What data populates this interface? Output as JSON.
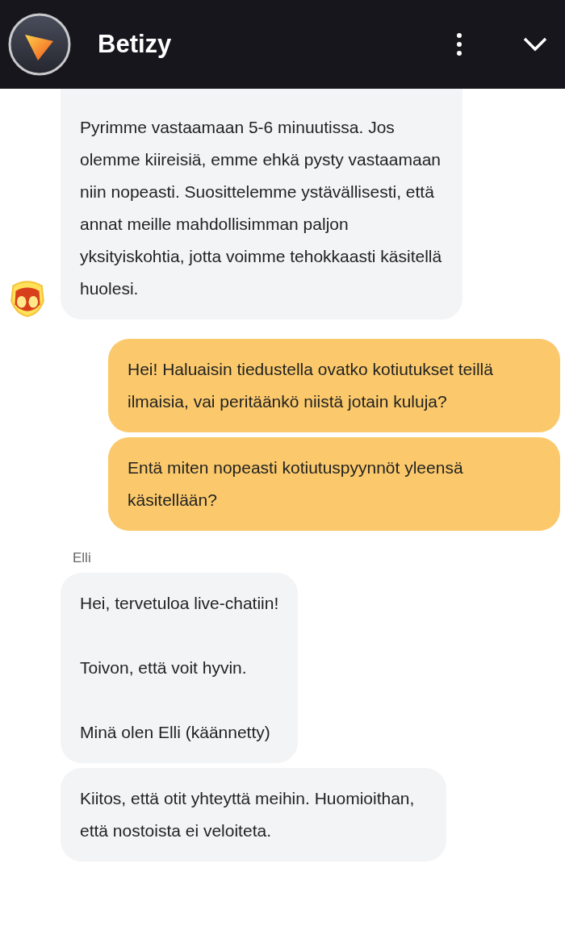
{
  "header": {
    "title": "Betizy"
  },
  "groups": [
    {
      "kind": "agent",
      "avatar": true,
      "messages": [
        "Pyrimme vastaamaan 5-6 minuutissa. Jos olemme kiireisiä, emme ehkä pysty vastaamaan niin nopeasti. Suosittelemme ystävällisesti, että annat meille mahdollisimman paljon yksityiskohtia, jotta voimme tehokkaasti käsitellä huolesi."
      ]
    },
    {
      "kind": "user",
      "messages": [
        "Hei! Haluaisin tiedustella ovatko kotiutukset teillä ilmaisia, vai peritäänkö niistä jotain kuluja?",
        "Entä miten nopeasti kotiutuspyynnöt yleensä käsitellään?"
      ]
    },
    {
      "kind": "agent",
      "sender": "Elli",
      "avatar": false,
      "messages": [
        "Hei, tervetuloa live-chatiin!\n\nToivon, että voit hyvin.\n\nMinä olen Elli (käännetty)",
        "Kiitos, että otit yhteyttä meihin. Huomioithan, että nostoista ei veloiteta."
      ]
    }
  ]
}
